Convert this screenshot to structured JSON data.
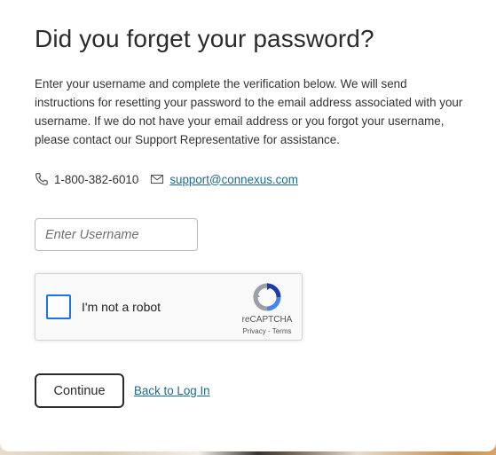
{
  "modal": {
    "title": "Did you forget your password?",
    "description": "Enter your username and complete the verification below. We will send instructions for resetting your password to the email address associated with your username. If we do not have your email address or you forgot your username, please contact our Support Representative for assistance."
  },
  "contact": {
    "phone": "1-800-382-6010",
    "email": "support@connexus.com",
    "phone_icon": "phone-icon",
    "email_icon": "mail-icon"
  },
  "form": {
    "username_placeholder": "Enter Username",
    "username_value": ""
  },
  "recaptcha": {
    "label": "I'm not a robot",
    "brand": "reCAPTCHA",
    "privacy": "Privacy",
    "separator": " - ",
    "terms": "Terms",
    "checked": false
  },
  "actions": {
    "continue_label": "Continue",
    "back_label": "Back to Log In"
  },
  "colors": {
    "link": "#1a6b8a",
    "checkbox_border": "#1a73e8",
    "text": "#333333"
  }
}
